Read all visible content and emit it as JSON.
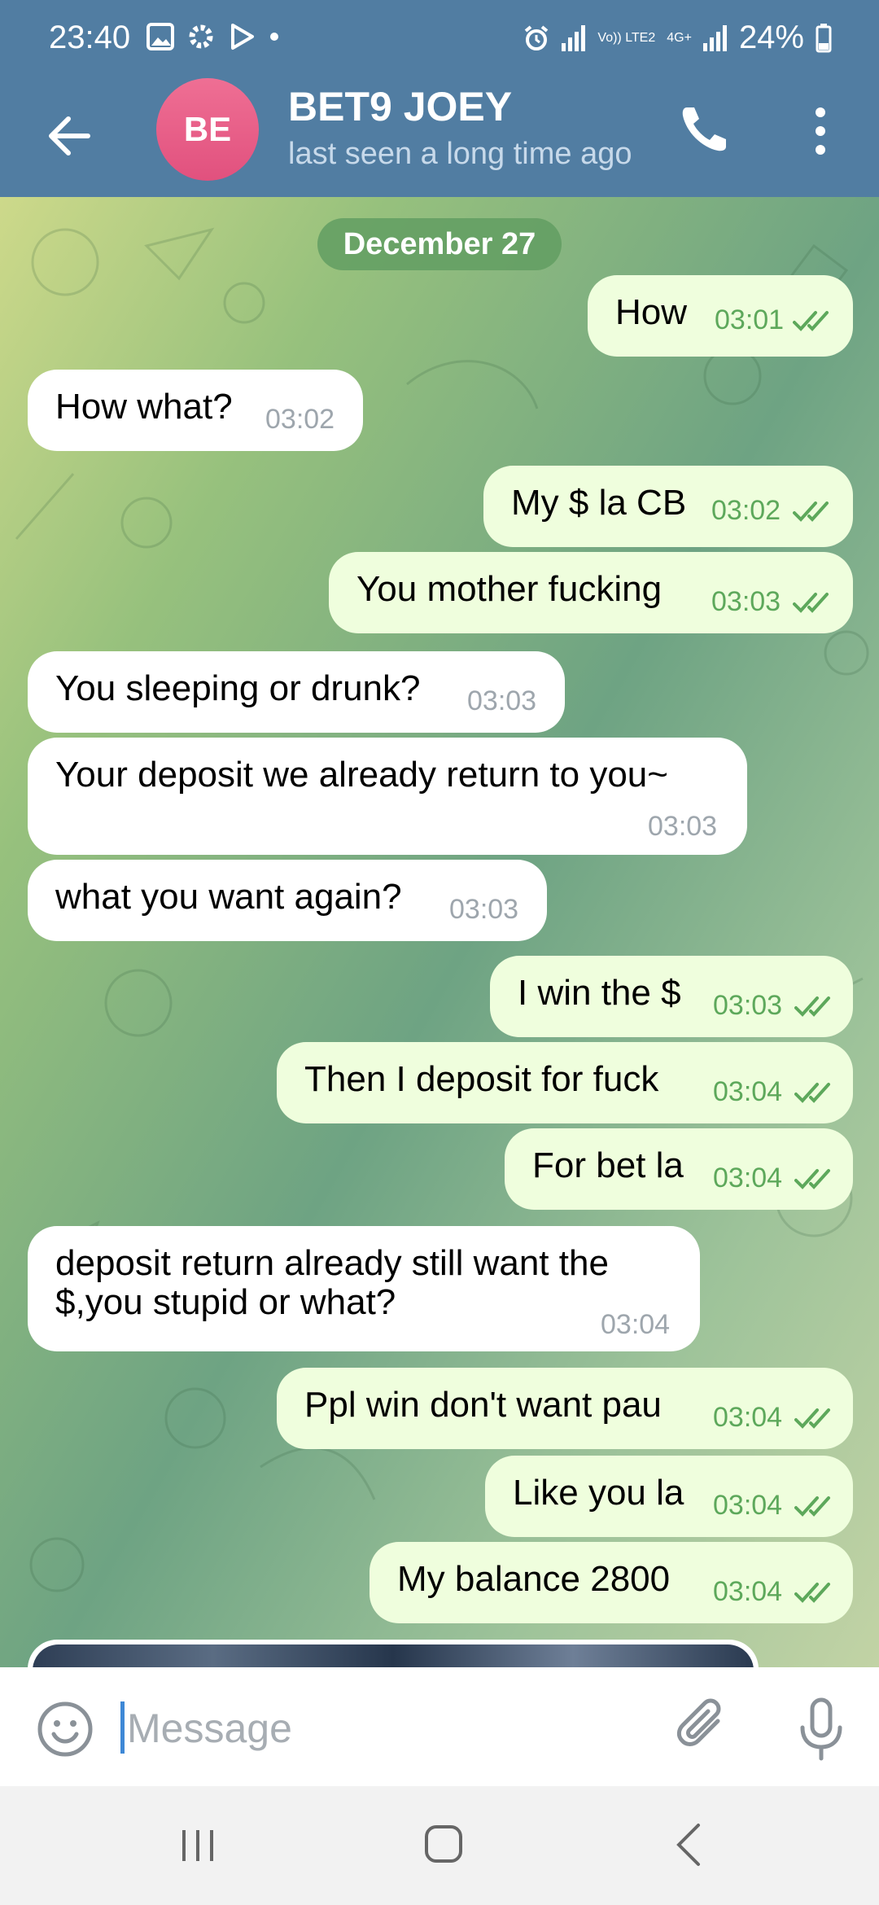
{
  "status_bar": {
    "time": "23:40",
    "network": "Vo)) LTE2",
    "network_2": "4G+",
    "battery": "24%"
  },
  "header": {
    "avatar_initials": "BE",
    "contact_name": "BET9 JOEY",
    "last_seen": "last seen a long time ago"
  },
  "chat": {
    "date_label": "December 27",
    "messages": [
      {
        "dir": "out",
        "text": "How",
        "time": "03:01"
      },
      {
        "dir": "in",
        "text": "How what?",
        "time": "03:02"
      },
      {
        "dir": "out",
        "text": "My $ la CB",
        "time": "03:02"
      },
      {
        "dir": "out",
        "text": "You mother fucking",
        "time": "03:03"
      },
      {
        "dir": "in",
        "text": "You sleeping or drunk?",
        "time": "03:03"
      },
      {
        "dir": "in",
        "text": "Your deposit we already return to you~",
        "time": "03:03"
      },
      {
        "dir": "in",
        "text": "what you want again?",
        "time": "03:03"
      },
      {
        "dir": "out",
        "text": "I win the $",
        "time": "03:03"
      },
      {
        "dir": "out",
        "text": "Then I deposit for fuck",
        "time": "03:04"
      },
      {
        "dir": "out",
        "text": "For bet la",
        "time": "03:04"
      },
      {
        "dir": "in",
        "text": "deposit return already still want the\n$,you stupid or what?",
        "time": "03:04"
      },
      {
        "dir": "out",
        "text": "Ppl win don't want pau",
        "time": "03:04"
      },
      {
        "dir": "out",
        "text": "Like you la",
        "time": "03:04"
      },
      {
        "dir": "out",
        "text": "My balance 2800",
        "time": "03:04"
      }
    ]
  },
  "composer": {
    "placeholder": "Message"
  },
  "icons": {
    "back": "arrow-left-icon",
    "call": "phone-icon",
    "menu": "more-vertical-icon",
    "emoji": "emoji-icon",
    "attach": "paperclip-icon",
    "mic": "microphone-icon",
    "read_receipt": "double-check-icon"
  },
  "colors": {
    "header": "#517da2",
    "outgoing_bubble": "#effedd",
    "incoming_bubble": "#ffffff",
    "date_chip": "#629e62",
    "avatar": "#e1517e",
    "check": "#5da85b"
  }
}
